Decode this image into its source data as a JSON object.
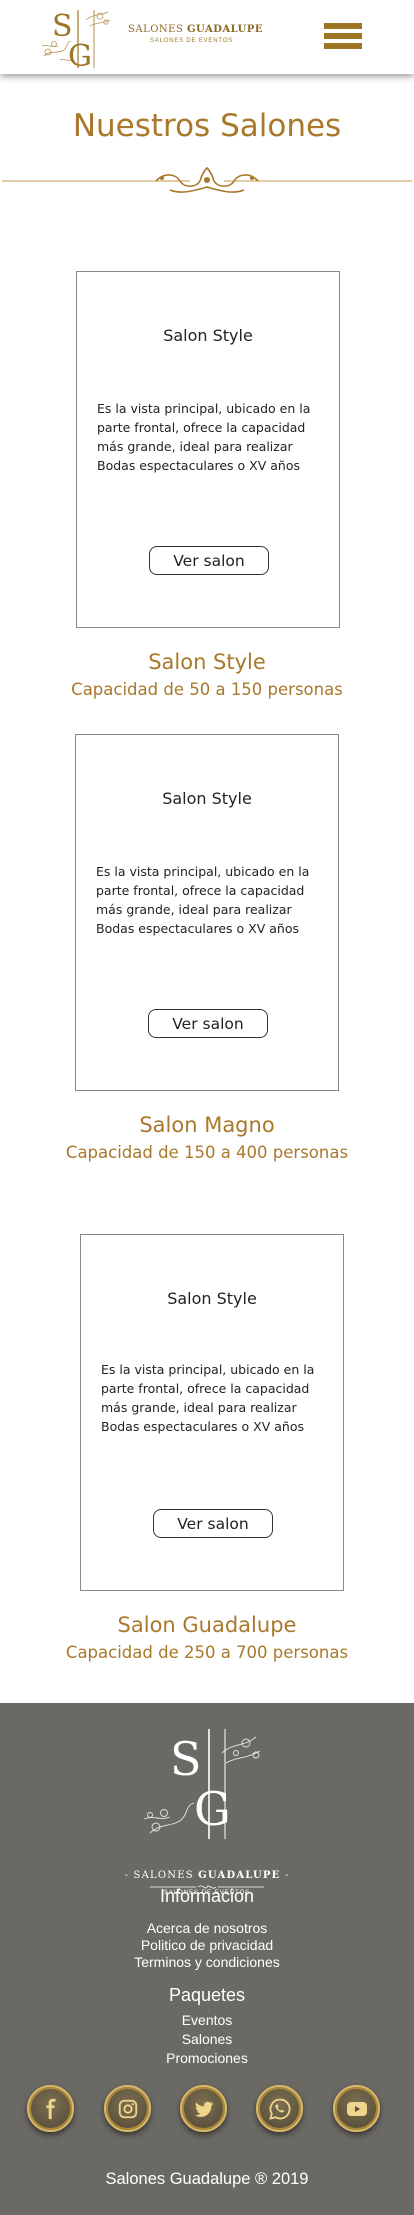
{
  "header": {
    "brand_name_light": "SALONES ",
    "brand_name_bold": "GUADALUPE",
    "brand_subtitle": "SALONES DE EVENTOS",
    "logo_monogram": "SG",
    "menu_icon": "hamburger-menu-icon"
  },
  "main": {
    "title": "Nuestros Salones",
    "cards": [
      {
        "card_title": "Salon Style",
        "description": "Es la vista principal, ubicado en la parte frontal, ofrece la capacidad más grande, ideal para realizar Bodas espectaculares o XV años",
        "button_label": "Ver salon",
        "salon_name": "Salon Style",
        "capacity": "Capacidad de 50 a 150 personas"
      },
      {
        "card_title": "Salon Style",
        "description": "Es la vista principal, ubicado en la parte frontal, ofrece la capacidad más grande, ideal para realizar Bodas espectaculares o XV años",
        "button_label": "Ver salon",
        "salon_name": "Salon Magno",
        "capacity": "Capacidad de 150 a 400 personas"
      },
      {
        "card_title": "Salon Style",
        "description": "Es la vista principal, ubicado en la parte frontal, ofrece la capacidad más grande, ideal para realizar Bodas espectaculares o XV años",
        "button_label": "Ver salon",
        "salon_name": "Salon Guadalupe",
        "capacity": "Capacidad de 250 a 700 personas"
      }
    ]
  },
  "footer": {
    "logo_name_prefix": "- SALONES ",
    "logo_name_bold": "GUADALUPE",
    "logo_name_suffix": " -",
    "logo_subtitle": "SALONES DE EVENTOS",
    "info_heading": "Informacion",
    "info_links": [
      "Acerca de nosotros",
      "Politico de privacidad",
      "Terminos y condiciones"
    ],
    "packages_heading": "Paquetes",
    "package_links": [
      "Eventos",
      "Salones",
      "Promociones"
    ],
    "social": [
      "facebook-icon",
      "instagram-icon",
      "twitter-icon",
      "whatsapp-icon",
      "youtube-icon"
    ],
    "copyright": "Salones Guadalupe ® 2019"
  },
  "colors": {
    "gold": "#a9782a",
    "footer_bg": "#6b6964",
    "menu": "#9c7424"
  }
}
